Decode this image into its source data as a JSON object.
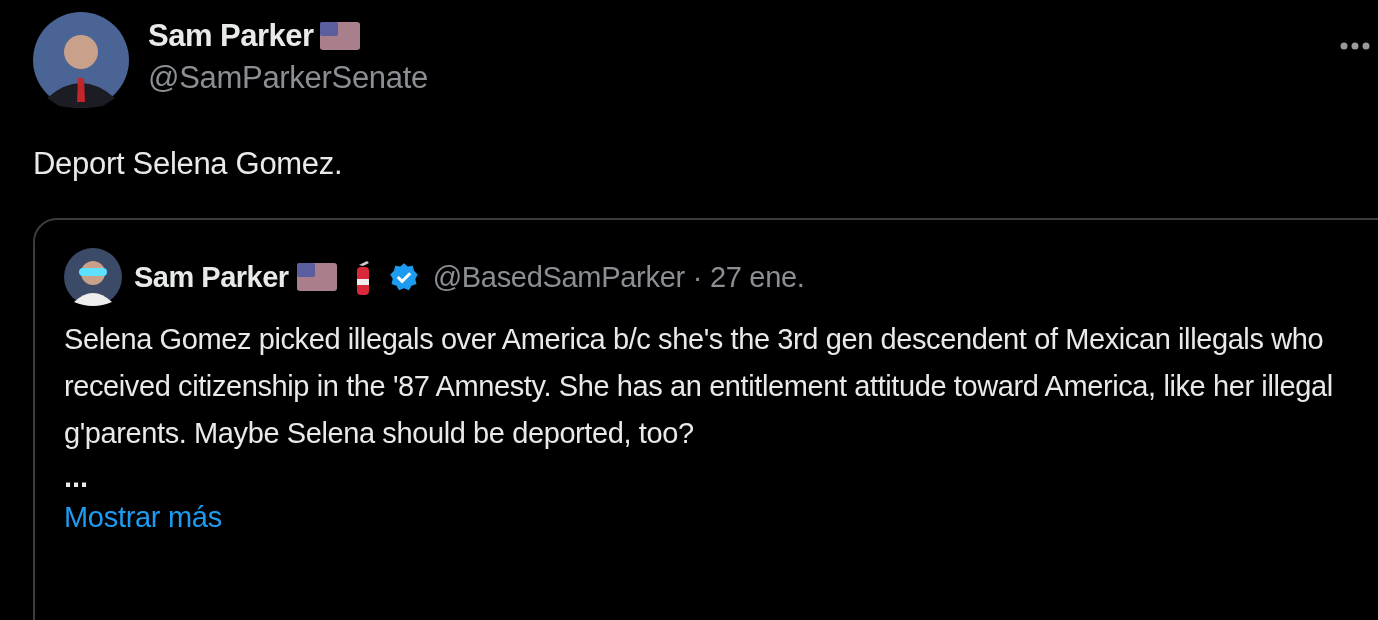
{
  "author": {
    "name": "Sam Parker",
    "handle": "@SamParkerSenate"
  },
  "text": "Deport Selena Gomez.",
  "quoted": {
    "author": {
      "name": "Sam Parker",
      "handle": "@BasedSamParker",
      "verified": true
    },
    "date": "· 27 ene.",
    "text": "Selena Gomez picked illegals over America b/c she's the 3rd gen descendent of Mexican illegals who received citizenship in the '87 Amnesty. She has an entitlement attitude toward America, like her illegal g'parents. Maybe Selena should be deported, too?",
    "ellipsis": "...",
    "show_more": "Mostrar más"
  }
}
